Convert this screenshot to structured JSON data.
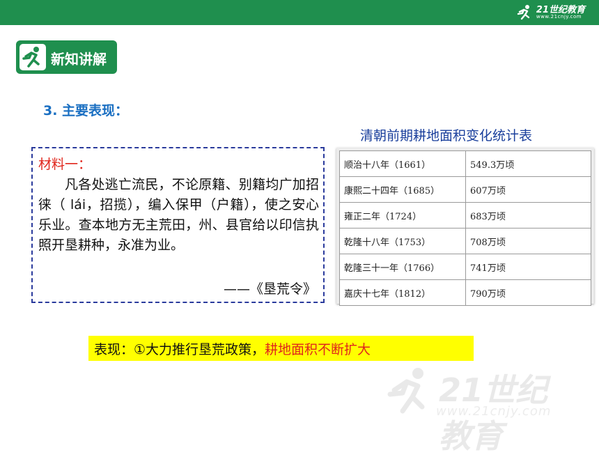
{
  "header": {
    "brand_name": "21世纪教育",
    "brand_url": "www.21cnjy.com"
  },
  "section": {
    "label": "新知讲解"
  },
  "heading": "3. 主要表现：",
  "material": {
    "label": "材料一：",
    "body": "凡各处逃亡流民，不论原籍、别籍均广加招徕（ lái，招揽），编入保甲（户籍），使之安心乐业。查本地方无主荒田，州、县官给以印信执照开垦耕种，永准为业。",
    "source": "——《垦荒令》"
  },
  "table": {
    "title": "清朝前期耕地面积变化统计表",
    "rows": [
      [
        "顺治十八年（1661）",
        "549.3万顷"
      ],
      [
        "康熙二十四年（1685）",
        "607万顷"
      ],
      [
        "雍正二年（1724）",
        "683万顷"
      ],
      [
        "乾隆十八年（1753）",
        "708万顷"
      ],
      [
        "乾隆三十一年（1766）",
        "741万顷"
      ],
      [
        "嘉庆十七年（1812）",
        "790万顷"
      ]
    ]
  },
  "summary": {
    "prefix": "表现：①大力推行垦荒政策，",
    "highlight": "耕地面积不断扩大"
  },
  "watermark": {
    "text": "21世纪教育",
    "url": "www.21cnjy.com"
  },
  "colors": {
    "brand_green": "#1f8f4e",
    "heading_blue": "#1a6fc2",
    "accent_red": "#e0261c",
    "highlight_yellow": "#ffff00",
    "title_blue": "#1a3f9c"
  },
  "icons": {
    "brand": "running-person-icon",
    "section": "running-person-icon"
  }
}
